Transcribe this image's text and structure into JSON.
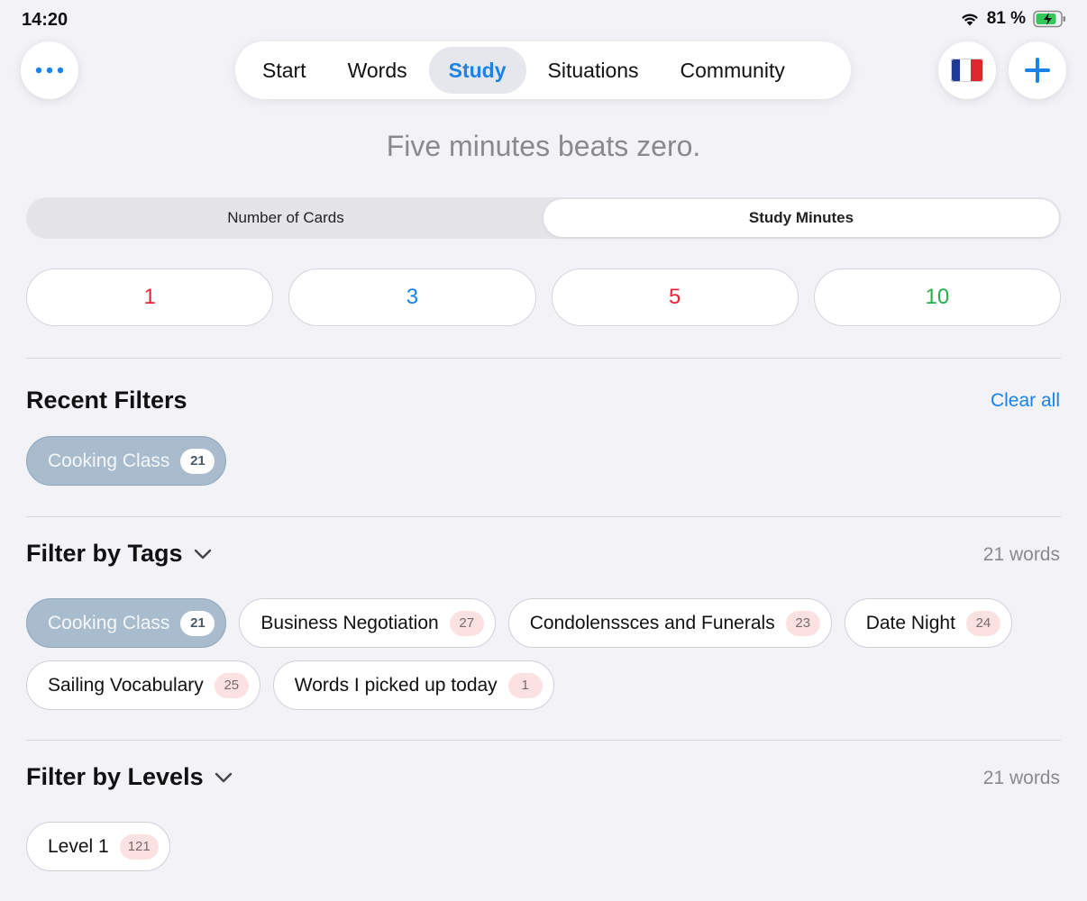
{
  "status_bar": {
    "time": "14:20",
    "battery": "81 %"
  },
  "toolbar": {
    "menu_icon": "ellipsis-icon",
    "flag": "🇫🇷",
    "add_icon": "plus-icon"
  },
  "nav": {
    "tabs": [
      {
        "label": "Start",
        "active": false
      },
      {
        "label": "Words",
        "active": false
      },
      {
        "label": "Study",
        "active": true
      },
      {
        "label": "Situations",
        "active": false
      },
      {
        "label": "Community",
        "active": false
      }
    ]
  },
  "tagline": "Five minutes beats zero.",
  "mode_selector": {
    "options": [
      "Number of Cards",
      "Study Minutes"
    ],
    "selected": "Study Minutes"
  },
  "minutes": [
    {
      "label": "1",
      "color": "#e5243b"
    },
    {
      "label": "3",
      "color": "#1a82e8"
    },
    {
      "label": "5",
      "color": "#e5243b"
    },
    {
      "label": "10",
      "color": "#22b14c"
    }
  ],
  "recent_filters": {
    "title": "Recent Filters",
    "clear_label": "Clear all",
    "chips": [
      {
        "label": "Cooking Class",
        "count": "21",
        "selected": true
      }
    ]
  },
  "tags": {
    "title": "Filter by Tags",
    "word_count": "21 words",
    "chips": [
      {
        "label": "Cooking Class",
        "count": "21",
        "selected": true
      },
      {
        "label": "Business Negotiation",
        "count": "27",
        "selected": false
      },
      {
        "label": "Condolenssces and Funerals",
        "count": "23",
        "selected": false
      },
      {
        "label": "Date Night",
        "count": "24",
        "selected": false
      },
      {
        "label": "Sailing Vocabulary",
        "count": "25",
        "selected": false
      },
      {
        "label": "Words I picked up today",
        "count": "1",
        "selected": false
      }
    ]
  },
  "levels": {
    "title": "Filter by Levels",
    "word_count": "21 words",
    "chips": [
      {
        "label": "Level 1",
        "count": "121",
        "selected": false
      }
    ]
  }
}
